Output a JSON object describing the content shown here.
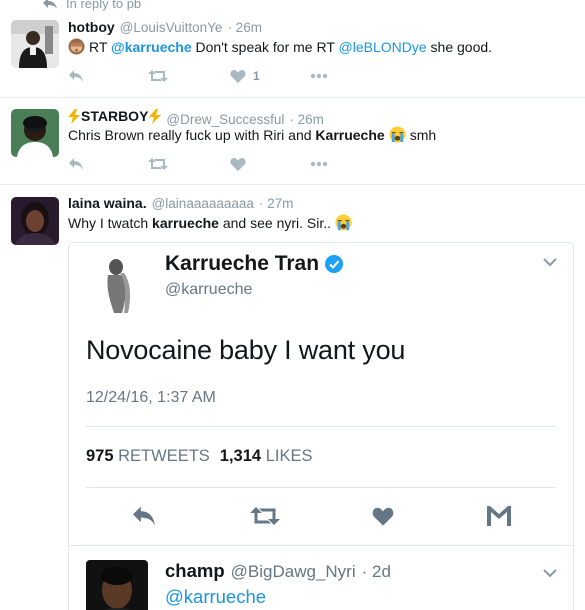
{
  "reply_context": {
    "label": "In reply to pb",
    "icon": "reply-arrow-icon"
  },
  "tweets": [
    {
      "name": "hotboy",
      "handle": "@LouisVuittonYe",
      "time": "· 26m",
      "text_parts": [
        "RT ",
        "@karrueche",
        " Don't speak for me RT ",
        "@leBLONDye",
        " she good."
      ],
      "emoji": "see-no-evil-monkey",
      "like_count": "1"
    },
    {
      "name_prefix_emoji": "lightning-icon",
      "name": "STARBOY",
      "name_suffix_emoji": "lightning-icon",
      "handle": "@Drew_Successful",
      "time": "· 26m",
      "text_parts": [
        "Chris Brown really fuck up with Riri and ",
        "Karrueche",
        " smh"
      ],
      "emoji": "loudly-crying-face"
    },
    {
      "name": "laina waina.",
      "handle": "@lainaaaaaaaaa",
      "time": "· 27m",
      "text_parts": [
        "Why I twatch ",
        "karrueche",
        " and see nyri. Sir.."
      ],
      "emoji": "loudly-crying-face"
    }
  ],
  "embedded": {
    "name": "Karrueche Tran",
    "verified": true,
    "handle": "@karrueche",
    "text": "Novocaine baby I want you",
    "date": "12/24/16, 1:37 AM",
    "retweets_num": "975",
    "retweets_label": "RETWEETS",
    "likes_num": "1,314",
    "likes_label": "LIKES"
  },
  "embedded_reply": {
    "name": "champ",
    "handle": "@BigDawg_Nyri",
    "time": "· 2d",
    "text": "@karrueche"
  },
  "colors": {
    "link": "#1b95e0",
    "muted": "#8899a6",
    "verified": "#1da1f2"
  }
}
